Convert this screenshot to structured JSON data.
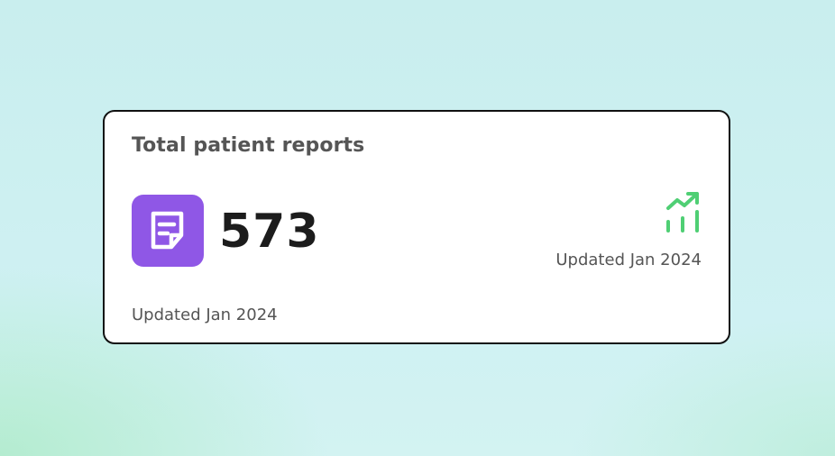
{
  "card": {
    "title": "Total patient reports",
    "count": "573",
    "updated_right": "Updated Jan 2024",
    "updated_bottom": "Updated Jan 2024",
    "icon": "document-note-icon",
    "trend_icon": "trending-up-bars-icon"
  },
  "colors": {
    "icon_bg": "#8f57e6",
    "trend": "#4fcf74",
    "border": "#111111"
  }
}
